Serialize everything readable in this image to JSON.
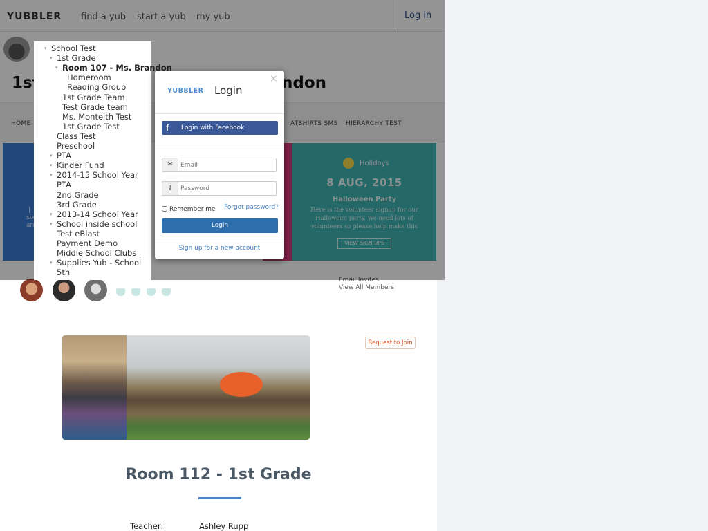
{
  "app": {
    "logo": "YUBBLER",
    "nav": [
      "find a yub",
      "start a yub",
      "my yub"
    ],
    "login": "Log in"
  },
  "page": {
    "title_start": "1st",
    "title_end": "ndon"
  },
  "subnav": {
    "items": [
      "HOME",
      "ATSHIRTS SMS",
      "HIERARCHY TEST"
    ]
  },
  "tiles": {
    "blue_lines": [
      "|",
      "six",
      "are"
    ],
    "teal": {
      "tag": "Holidays",
      "date": "8 AUG, 2015",
      "event": "Halloween Party",
      "desc": "Here is the volunteer signup for our Halloween party. We need lots of volunteers so please help make this",
      "button": "VIEW SIGN UPS",
      "icon": "sun-icon"
    }
  },
  "tree": {
    "items": [
      {
        "label": "School Test",
        "level": 0,
        "caret": true
      },
      {
        "label": "1st Grade",
        "level": 1,
        "caret": true
      },
      {
        "label": "Room 107 - Ms. Brandon",
        "level": 2,
        "caret": true,
        "bold": true
      },
      {
        "label": "Homeroom",
        "level": 3
      },
      {
        "label": "Reading Group",
        "level": 3
      },
      {
        "label": "1st Grade Team",
        "level": 2
      },
      {
        "label": "Test Grade team",
        "level": 2
      },
      {
        "label": "Ms. Monteith Test",
        "level": 2
      },
      {
        "label": "1st Grade Test",
        "level": 2
      },
      {
        "label": "Class Test",
        "level": 1
      },
      {
        "label": "Preschool",
        "level": 1
      },
      {
        "label": "PTA",
        "level": 1,
        "caret": true
      },
      {
        "label": "Kinder Fund",
        "level": 1,
        "caret": true
      },
      {
        "label": "2014-15 School Year",
        "level": 1,
        "caret": true
      },
      {
        "label": "PTA",
        "level": 1
      },
      {
        "label": "2nd Grade",
        "level": 1
      },
      {
        "label": "3rd Grade",
        "level": 1
      },
      {
        "label": "2013-14 School Year",
        "level": 1,
        "caret": true
      },
      {
        "label": "School inside school",
        "level": 1,
        "caret": true
      },
      {
        "label": "Test eBlast",
        "level": 1
      },
      {
        "label": "Payment Demo",
        "level": 1
      },
      {
        "label": "Middle School Clubs",
        "level": 1
      },
      {
        "label": "Supplies Yub - School",
        "level": 1,
        "caret": true
      },
      {
        "label": "5th",
        "level": 1
      }
    ]
  },
  "modal": {
    "logo": "YUBBLER",
    "title": "Login",
    "close": "×",
    "facebook": "Login with Facebook",
    "email_placeholder": "Email",
    "password_placeholder": "Password",
    "remember": "Remember me",
    "forgot": "Forgot password?",
    "login": "Login",
    "signup": "Sign up for a new account",
    "icons": {
      "email": "envelope-icon",
      "password": "key-icon",
      "facebook": "facebook-icon"
    }
  },
  "members": {
    "email_invites": "Email Invites",
    "view_all": "View All Members",
    "request": "Request to Join"
  },
  "group": {
    "title": "Room 112 - 1st Grade",
    "teacher_label": "Teacher:",
    "teacher": "Ashley Rupp"
  },
  "colors": {
    "facebook": "#3b5998",
    "primary": "#2f6ead",
    "teal": "#3fb3b4",
    "blue_tile": "#3a7bd5",
    "pink_tile": "#d8357a",
    "request": "#d9541e"
  }
}
